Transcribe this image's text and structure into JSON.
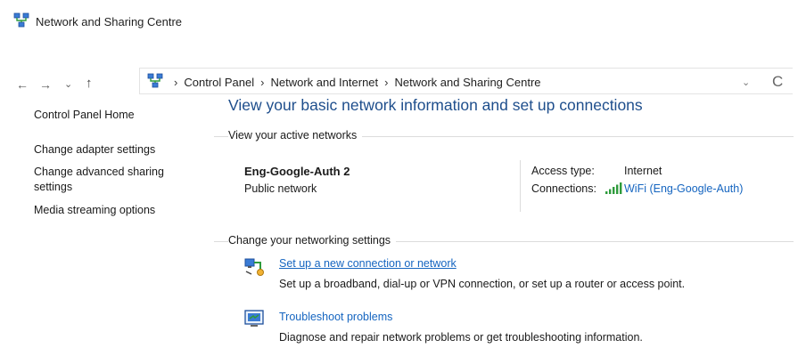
{
  "window": {
    "title": "Network and Sharing Centre"
  },
  "icons": {
    "window": "network-center-icon",
    "address": "network-center-icon",
    "back": "arrow-left-icon",
    "forward": "arrow-right-icon",
    "recent": "chevron-down-icon",
    "up": "arrow-up-icon",
    "address_dropdown": "chevron-down-icon",
    "refresh": "refresh-icon",
    "signal": "wifi-signal-bars-icon",
    "new_connection": "new-connection-icon",
    "troubleshoot": "troubleshoot-icon"
  },
  "nav": {
    "back": "←",
    "forward": "→",
    "recent": "⌄",
    "up": "↑",
    "dropdown": "⌄",
    "refresh": "C"
  },
  "breadcrumb": {
    "separator": "›",
    "items": [
      "Control Panel",
      "Network and Internet",
      "Network and Sharing Centre"
    ]
  },
  "sidebar": {
    "items": [
      "Control Panel Home",
      "Change adapter settings",
      "Change advanced sharing settings",
      "Media streaming options"
    ]
  },
  "main": {
    "heading": "View your basic network information and set up connections",
    "active_networks_label": "View your active networks",
    "network": {
      "name": "Eng-Google-Auth 2",
      "category": "Public network",
      "access_type_label": "Access type:",
      "access_type_value": "Internet",
      "connections_label": "Connections:",
      "connection_value": "WiFi (Eng-Google-Auth)"
    },
    "change_settings_label": "Change your networking settings",
    "tasks": [
      {
        "title": "Set up a new connection or network",
        "description": "Set up a broadband, dial-up or VPN connection, or set up a router or access point."
      },
      {
        "title": "Troubleshoot problems",
        "description": "Diagnose and repair network problems or get troubleshooting information."
      }
    ]
  },
  "colors": {
    "heading": "#1e4e8c",
    "link": "#1565c0",
    "signal": "#2e9b3c",
    "background": "#ffffff"
  }
}
